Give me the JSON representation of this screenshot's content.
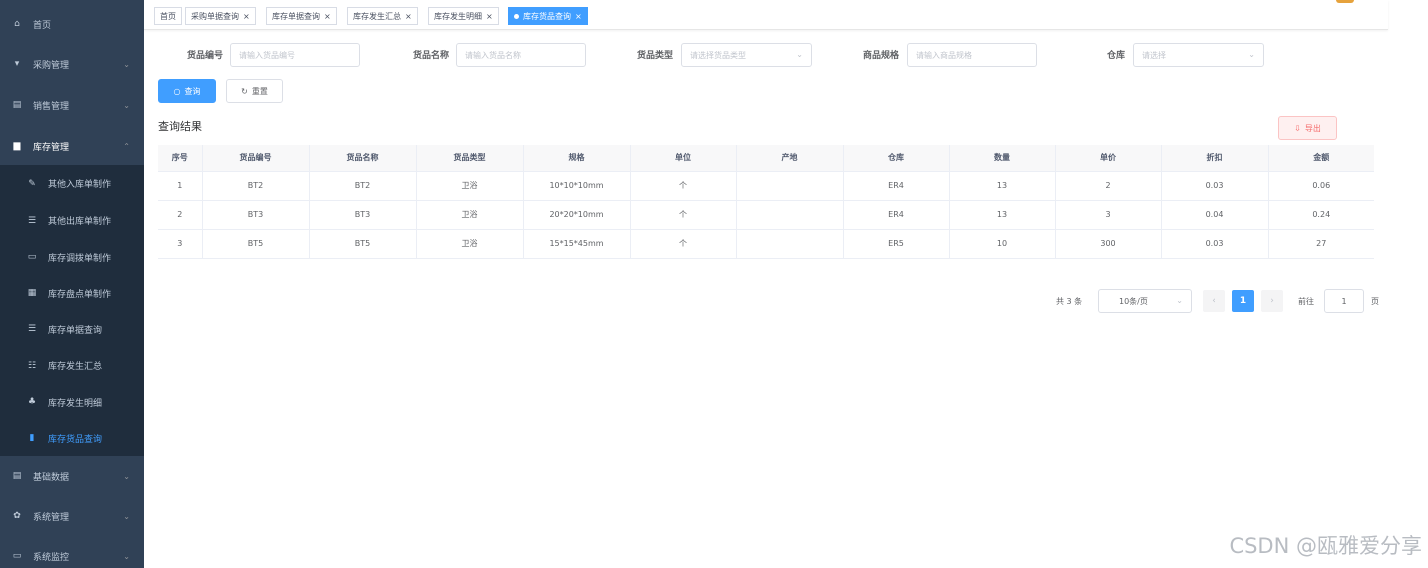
{
  "sidebar": {
    "items": [
      {
        "icon": "home-icon",
        "glyph": "⌂",
        "label": "首页",
        "chevron": ""
      },
      {
        "icon": "cart-icon",
        "glyph": "▾",
        "label": "采购管理",
        "chevron": "⌄"
      },
      {
        "icon": "document-icon",
        "glyph": "▤",
        "label": "销售管理",
        "chevron": "⌄"
      },
      {
        "icon": "folder-icon",
        "glyph": "▆",
        "label": "库存管理",
        "chevron": "⌃"
      }
    ],
    "sub_items": [
      {
        "icon": "edit-icon",
        "glyph": "✎",
        "label": "其他入库单制作"
      },
      {
        "icon": "list-icon",
        "glyph": "☰",
        "label": "其他出库单制作"
      },
      {
        "icon": "monitor-icon",
        "glyph": "▭",
        "label": "库存调拨单制作"
      },
      {
        "icon": "table-icon",
        "glyph": "▦",
        "label": "库存盘点单制作"
      },
      {
        "icon": "list-check-icon",
        "glyph": "☰",
        "label": "库存单据查询"
      },
      {
        "icon": "tree-table-icon",
        "glyph": "☷",
        "label": "库存发生汇总"
      },
      {
        "icon": "hierarchy-icon",
        "glyph": "♣",
        "label": "库存发生明细"
      },
      {
        "icon": "phone-icon",
        "glyph": "▮",
        "label": "库存货品查询"
      }
    ],
    "bottom_items": [
      {
        "icon": "database-icon",
        "glyph": "▤",
        "label": "基础数据",
        "chevron": "⌄"
      },
      {
        "icon": "settings-icon",
        "glyph": "✿",
        "label": "系统管理",
        "chevron": "⌄"
      },
      {
        "icon": "monitor-icon",
        "glyph": "▭",
        "label": "系统监控",
        "chevron": "⌄"
      }
    ]
  },
  "tags": [
    {
      "label": "首页",
      "closable": false
    },
    {
      "label": "采购单据查询",
      "closable": true
    },
    {
      "label": "库存单据查询",
      "closable": true
    },
    {
      "label": "库存发生汇总",
      "closable": true
    },
    {
      "label": "库存发生明细",
      "closable": true
    },
    {
      "label": "库存货品查询",
      "closable": true,
      "active": true
    }
  ],
  "close_glyph": "×",
  "search": {
    "fields": [
      {
        "label": "货品编号",
        "placeholder": "请输入货品编号",
        "type": "text"
      },
      {
        "label": "货品名称",
        "placeholder": "请输入货品名称",
        "type": "text"
      },
      {
        "label": "货品类型",
        "placeholder": "请选择货品类型",
        "type": "select"
      },
      {
        "label": "商品规格",
        "placeholder": "请输入商品规格",
        "type": "text"
      },
      {
        "label": "仓库",
        "placeholder": "请选择",
        "type": "select"
      }
    ],
    "query_label": "查询",
    "reset_label": "重置",
    "query_icon": "○",
    "reset_icon": "↻"
  },
  "result_title": "查询结果",
  "export_label": "导出",
  "export_icon": "⇩",
  "table": {
    "columns": [
      "序号",
      "货品编号",
      "货品名称",
      "货品类型",
      "规格",
      "单位",
      "产地",
      "仓库",
      "数量",
      "单价",
      "折扣",
      "金额"
    ],
    "rows": [
      [
        "1",
        "BT2",
        "BT2",
        "卫浴",
        "10*10*10mm",
        "个",
        "",
        "ER4",
        "13",
        "2",
        "0.03",
        "0.06"
      ],
      [
        "2",
        "BT3",
        "BT3",
        "卫浴",
        "20*20*10mm",
        "个",
        "",
        "ER4",
        "13",
        "3",
        "0.04",
        "0.24"
      ],
      [
        "3",
        "BT5",
        "BT5",
        "卫浴",
        "15*15*45mm",
        "个",
        "",
        "ER5",
        "10",
        "300",
        "0.03",
        "27"
      ]
    ]
  },
  "pagination": {
    "total": "共 3 条",
    "page_size": "10条/页",
    "current": "1",
    "goto_label": "前往",
    "goto_value": "1",
    "page_suffix": "页",
    "prev_glyph": "‹",
    "next_glyph": "›"
  },
  "watermark": "CSDN @瓯雅爱分享"
}
